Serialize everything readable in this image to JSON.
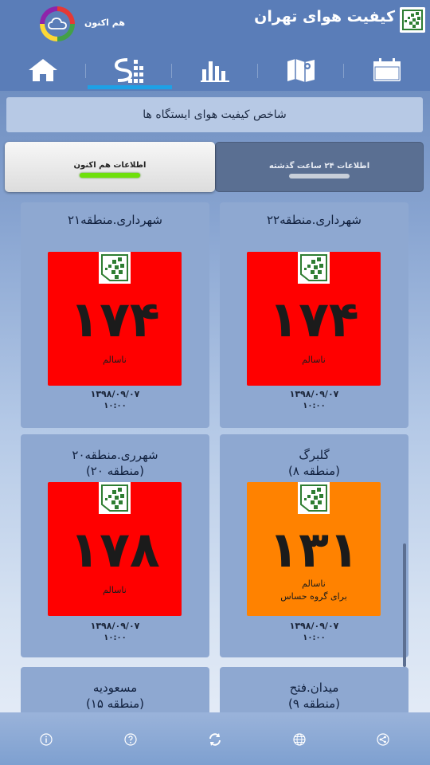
{
  "header": {
    "title": "کیفیت هوای تهران",
    "now_label": "هم اکنون",
    "weather_icon": "cloud-icon"
  },
  "tabs": [
    {
      "name": "calendar",
      "icon": "calendar-icon",
      "active": false
    },
    {
      "name": "map",
      "icon": "map-icon",
      "active": false
    },
    {
      "name": "chart",
      "icon": "bar-chart-icon",
      "active": false
    },
    {
      "name": "stations",
      "icon": "stations-icon",
      "active": true
    },
    {
      "name": "home",
      "icon": "home-icon",
      "active": false
    }
  ],
  "section_title": "شاخص کیفیت هوای ایستگاه ها",
  "toggle": {
    "now_label": "اطلاعات هم اکنون",
    "past24_label": "اطلاعات ۲۴ ساعت گذشته"
  },
  "stations": [
    {
      "name": "شهرداری.منطقه۲۲",
      "aqi": "۱۷۴",
      "status": "ناسالم",
      "status2": "",
      "date": "۱۳۹۸/۰۹/۰۷",
      "time": "۱۰:۰۰",
      "color": "#ff0000"
    },
    {
      "name": "شهرداری.منطقه۲۱",
      "aqi": "۱۷۴",
      "status": "ناسالم",
      "status2": "",
      "date": "۱۳۹۸/۰۹/۰۷",
      "time": "۱۰:۰۰",
      "color": "#ff0000"
    },
    {
      "name": "گلبرگ",
      "name2": "(منطقه ۸)",
      "aqi": "۱۳۱",
      "status": "ناسالم",
      "status2": "برای گروه حساس",
      "date": "۱۳۹۸/۰۹/۰۷",
      "time": "۱۰:۰۰",
      "color": "#ff8200"
    },
    {
      "name": "شهرری.منطقه۲۰",
      "name2": "(منطقه ۲۰)",
      "aqi": "۱۷۸",
      "status": "ناسالم",
      "status2": "",
      "date": "۱۳۹۸/۰۹/۰۷",
      "time": "۱۰:۰۰",
      "color": "#ff0000"
    },
    {
      "name": "میدان.فتح",
      "name2": "(منطقه ۹)"
    },
    {
      "name": "مسعودیه",
      "name2": "(منطقه ۱۵)"
    }
  ],
  "bottom_bar": [
    {
      "icon": "share-icon"
    },
    {
      "icon": "globe-icon"
    },
    {
      "icon": "refresh-icon"
    },
    {
      "icon": "help-icon"
    },
    {
      "icon": "info-icon"
    }
  ],
  "colors": {
    "header_bg": "#5a7db8",
    "active_tab": "#1ea1e6",
    "unhealthy": "#ff0000",
    "unhealthy_sensitive": "#ff8200",
    "toggle_indicator": "#6ee00a"
  }
}
